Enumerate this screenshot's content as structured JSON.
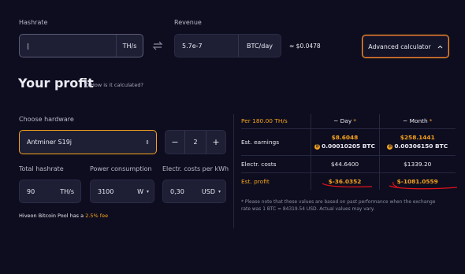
{
  "hashrate": {
    "label": "Hashrate",
    "value": "|",
    "unit": "TH/s"
  },
  "revenue": {
    "label": "Revenue",
    "value": "5.7e-7",
    "unit": "BTC/day",
    "usd": "≈ $0.0478"
  },
  "advanced_button": "Advanced calculator",
  "profit": {
    "title": "Your profit",
    "how": "How is it calculated?"
  },
  "hardware": {
    "label": "Choose hardware",
    "selected": "Antminer S19j",
    "quantity": "2"
  },
  "total_hashrate": {
    "label": "Total hashrate",
    "value": "90",
    "unit": "TH/s"
  },
  "power": {
    "label": "Power consumption",
    "value": "3100",
    "unit": "W"
  },
  "electricity": {
    "label": "Electr. costs per kWh",
    "value": "0,30",
    "unit": "USD"
  },
  "pool_note": {
    "prefix": "Hiveon Bitcoin Pool has a",
    "fee": "2.5% fee"
  },
  "table": {
    "header": {
      "per": "Per 180.00 TH/s",
      "day": "~ Day",
      "month": "~ Month",
      "star": "*"
    },
    "rows": {
      "earnings": {
        "label": "Est. earnings",
        "day_usd": "$8.6048",
        "day_btc": "0.00010205 BTC",
        "month_usd": "$258.1441",
        "month_btc": "0.00306150 BTC"
      },
      "costs": {
        "label": "Electr. costs",
        "day": "$44.6400",
        "month": "$1339.20"
      },
      "profit": {
        "label": "Est. profit",
        "day": "$-36.0352",
        "month": "$-1081.0559"
      }
    }
  },
  "disclaimer": "* Please note that these values are based on past performance when the exchange rate was 1 BTC = 84319.54 USD. Actual values may vary.",
  "colors": {
    "accent": "#f7a21b",
    "annotation": "#e3121b",
    "background": "#0d0d1f",
    "field": "#1e1f35"
  }
}
